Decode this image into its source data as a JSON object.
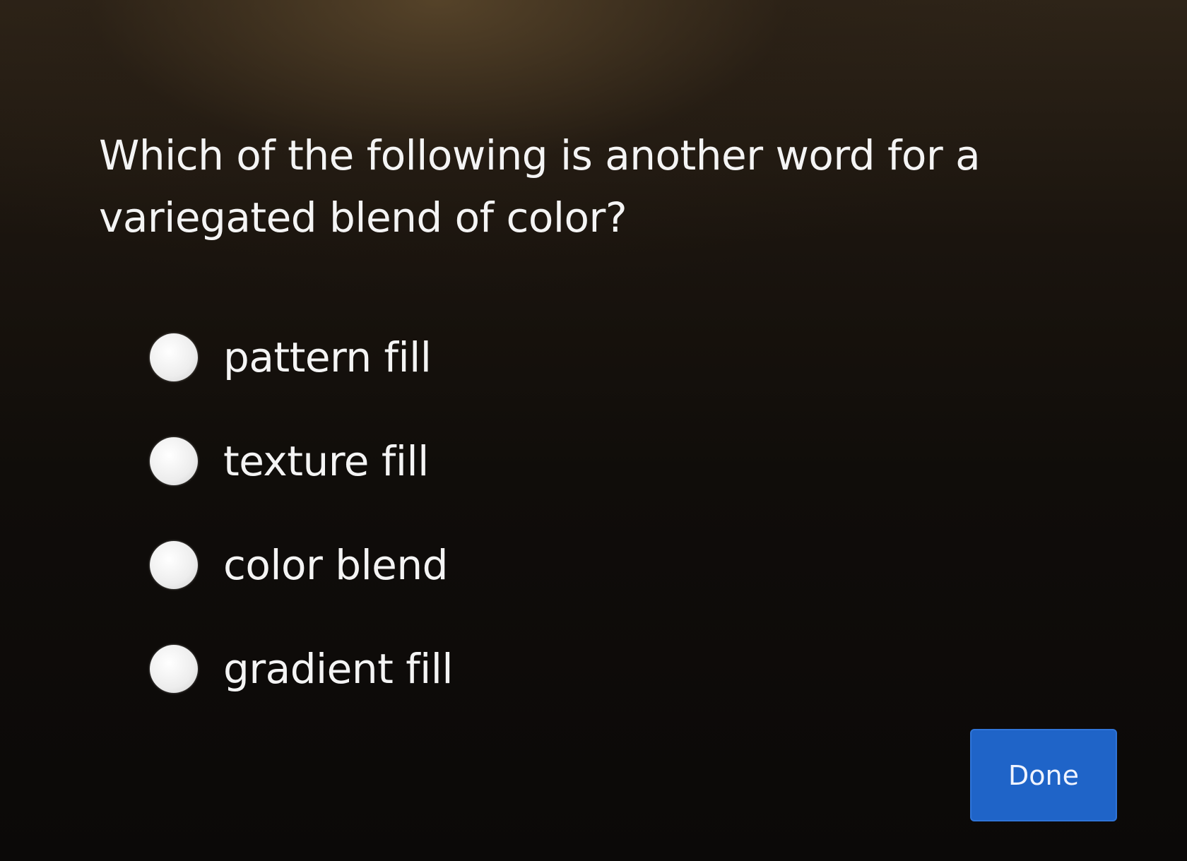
{
  "question": {
    "text": "Which of the following is another word for a variegated blend of color?"
  },
  "options": [
    {
      "label": "pattern fill",
      "selected": false
    },
    {
      "label": "texture fill",
      "selected": false
    },
    {
      "label": "color blend",
      "selected": false
    },
    {
      "label": "gradient fill",
      "selected": false
    }
  ],
  "done_button": {
    "label": "Done",
    "color": "#1f64c8"
  }
}
